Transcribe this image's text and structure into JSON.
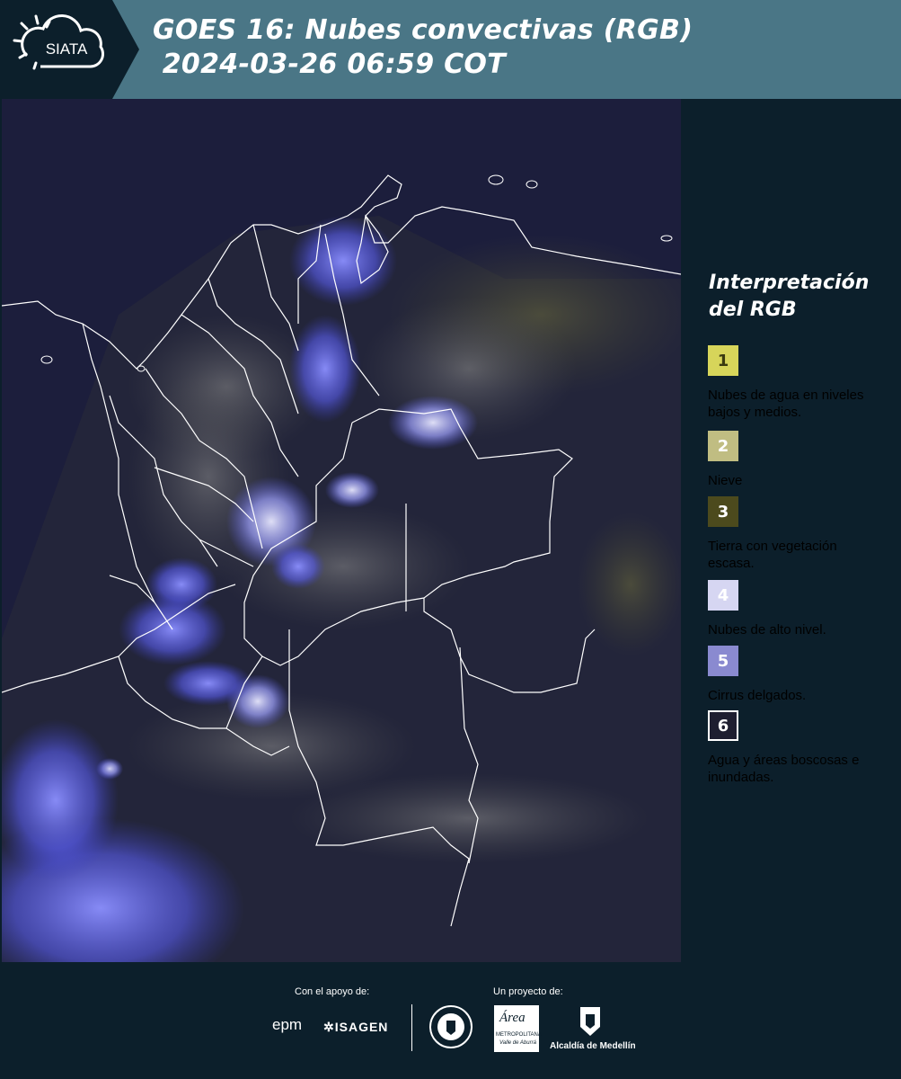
{
  "header": {
    "logo_text": "SIATA",
    "title_line1": "GOES 16: Nubes convectivas (RGB)",
    "title_line2": " 2024-03-26 06:59 COT"
  },
  "legend": {
    "title_line1": "Interpretación",
    "title_line2": "del RGB",
    "items": [
      {
        "number": "1",
        "color": "#d7d55a",
        "label": "Nubes de agua en niveles bajos y medios."
      },
      {
        "number": "2",
        "color": "#c0bd82",
        "label": "Nieve"
      },
      {
        "number": "3",
        "color": "#4c4a1d",
        "label": "Tierra con vegetación escasa."
      },
      {
        "number": "4",
        "color": "#d6d6f2",
        "label": "Nubes de alto nivel."
      },
      {
        "number": "5",
        "color": "#8a8ad0",
        "label": "Cirrus delgados."
      },
      {
        "number": "6",
        "color": "#1e1e30",
        "label": "Agua y áreas boscosas e inundadas."
      }
    ]
  },
  "footer": {
    "support_label": "Con el apoyo de:",
    "project_label": "Un proyecto de:",
    "sponsor_epm": "epm",
    "sponsor_isagen": "ISAGEN",
    "sponsor_area_name": "Área",
    "sponsor_area_sub1": "METROPOLITANA",
    "sponsor_area_sub2": "Valle de Aburrá",
    "sponsor_alcaldia": "Alcaldía de Medellín"
  },
  "colors": {
    "header_bg": "#4a7686",
    "logo_bg": "#0c1f2b",
    "page_bg": "#0c1f2b",
    "map_bg": "#1a1c3a",
    "cloud_blue": "#5a5ef0",
    "border_lines": "#ffffff"
  }
}
